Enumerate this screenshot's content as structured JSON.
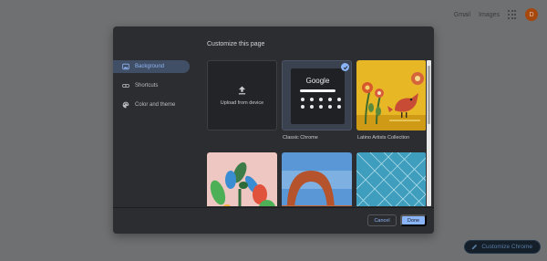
{
  "page": {
    "top_links": [
      "Gmail",
      "Images"
    ],
    "avatar_initial": "D",
    "customize_button": "Customize Chrome"
  },
  "dialog": {
    "title": "Customize this page",
    "nav": [
      {
        "label": "Background",
        "icon": "background-icon",
        "active": true
      },
      {
        "label": "Shortcuts",
        "icon": "link-icon",
        "active": false
      },
      {
        "label": "Color and theme",
        "icon": "palette-icon",
        "active": false
      }
    ],
    "tiles": {
      "upload_label": "Upload from device",
      "classic": {
        "label": "Classic Chrome",
        "logo_text": "Google",
        "selected": true
      },
      "latino": {
        "label": "Latino Artists Collection"
      }
    },
    "buttons": {
      "cancel": "Cancel",
      "done": "Done"
    }
  },
  "colors": {
    "accent": "#8ab4f8",
    "dialog_bg": "#2c2d30",
    "nav_active_bg": "#404f66"
  }
}
